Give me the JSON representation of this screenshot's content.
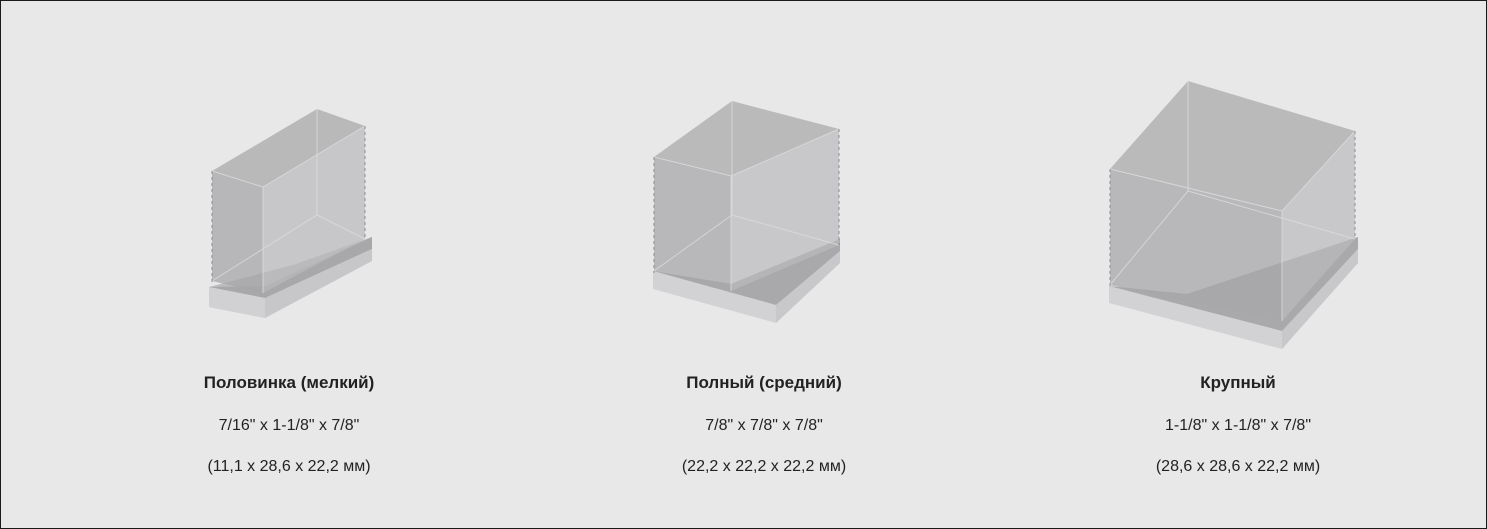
{
  "items": [
    {
      "name": "Половинка (мелкий)",
      "dims_in": "7/16\" x 1-1/8\" x 7/8\"",
      "dims_mm": "(11,1 x 28,6 x 22,2 мм)"
    },
    {
      "name": "Полный (средний)",
      "dims_in": "7/8\" x 7/8\" x 7/8\"",
      "dims_mm": "(22,2 x 22,2 x 22,2 мм)"
    },
    {
      "name": "Крупный",
      "dims_in": "1-1/8\" x 1-1/8\" x 7/8\"",
      "dims_mm": "(28,6 x 28,6 x 22,2 мм)"
    }
  ]
}
